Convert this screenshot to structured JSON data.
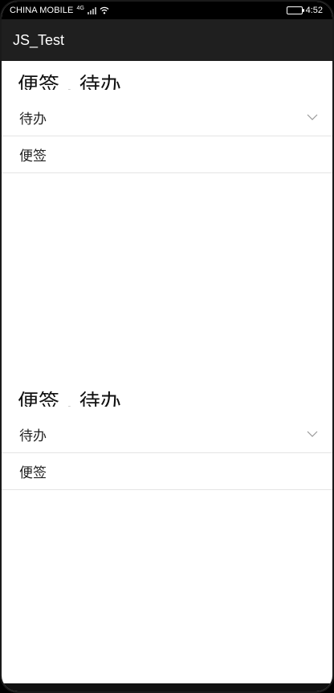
{
  "status_bar": {
    "carrier": "CHINA MOBILE",
    "network": "4G",
    "time": "4:52"
  },
  "app_bar": {
    "title": "JS_Test"
  },
  "groups": [
    {
      "title": "便签 . 待办",
      "items": [
        {
          "label": "待办",
          "expandable": true
        },
        {
          "label": "便签",
          "expandable": false
        }
      ]
    },
    {
      "title": "便签 . 待办",
      "items": [
        {
          "label": "待办",
          "expandable": true
        },
        {
          "label": "便签",
          "expandable": false
        }
      ]
    }
  ]
}
